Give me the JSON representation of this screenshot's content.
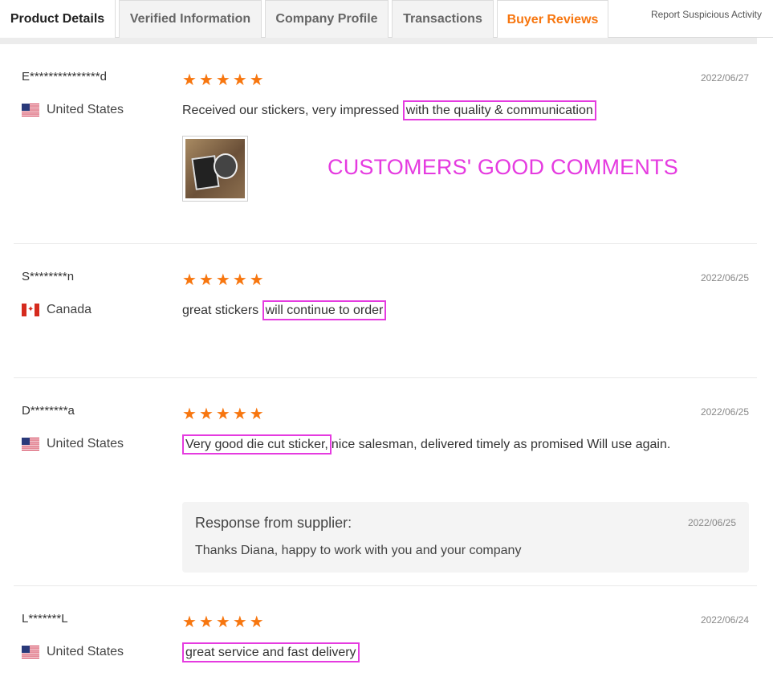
{
  "tabs": [
    {
      "label": "Product Details"
    },
    {
      "label": "Verified Information"
    },
    {
      "label": "Company Profile"
    },
    {
      "label": "Transactions"
    },
    {
      "label": "Buyer Reviews"
    }
  ],
  "active_tab": "Buyer Reviews",
  "report_label": "Report Suspicious Activity",
  "overlay_text": "CUSTOMERS' GOOD COMMENTS",
  "colors": {
    "accent": "#f7760f",
    "highlight": "#e53be0"
  },
  "rating_max": 5,
  "reviews": [
    {
      "name": "E***************d",
      "country": "United States",
      "flag": "us-flag-icon",
      "rating": 5,
      "date": "2022/06/27",
      "text_before": "Received our stickers, very impressed ",
      "text_highlight": "with the quality & communication",
      "text_after": ""
    },
    {
      "name": "S********n",
      "country": "Canada",
      "flag": "canada-flag-icon",
      "rating": 5,
      "date": "2022/06/25",
      "text_before": "great stickers ",
      "text_highlight": "will continue to order",
      "text_after": ""
    },
    {
      "name": "D********a",
      "country": "United States",
      "flag": "us-flag-icon",
      "rating": 5,
      "date": "2022/06/25",
      "text_before": "",
      "text_highlight": "Very good die cut sticker,",
      "text_after": "nice salesman, delivered timely as promised Will use again.",
      "response": {
        "title": "Response from supplier:",
        "date": "2022/06/25",
        "text": "Thanks Diana, happy to work with you and your company"
      }
    },
    {
      "name": "L*******L",
      "country": "United States",
      "flag": "us-flag-icon",
      "rating": 5,
      "date": "2022/06/24",
      "text_before": "",
      "text_highlight": "great service and fast delivery",
      "text_after": ""
    }
  ]
}
